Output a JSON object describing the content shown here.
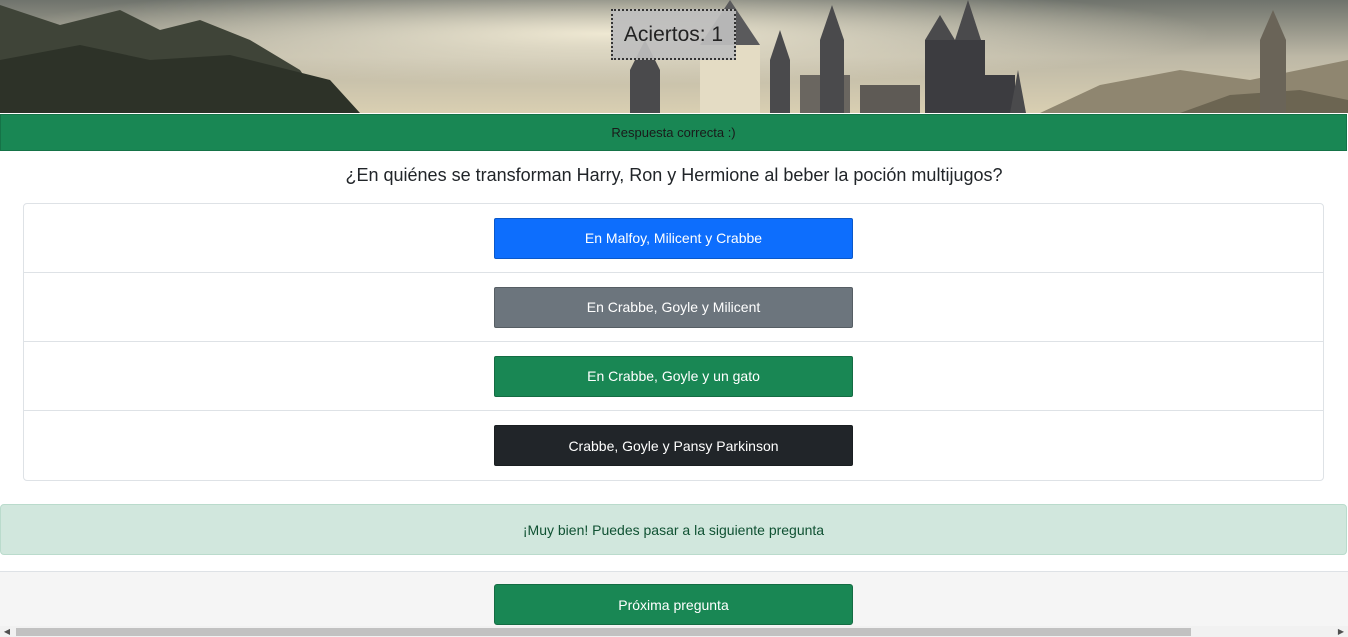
{
  "header": {
    "score_text": "Aciertos: 1"
  },
  "status": {
    "message": "Respuesta correcta :)"
  },
  "question": {
    "text": "¿En quiénes se transforman Harry, Ron y Hermione al beber la poción multijugos?"
  },
  "options": [
    {
      "label": "En Malfoy, Milicent y Crabbe",
      "color": "#0d6efd"
    },
    {
      "label": "En Crabbe, Goyle y Milicent",
      "color": "#6c757d"
    },
    {
      "label": "En Crabbe, Goyle y un gato",
      "color": "#198754"
    },
    {
      "label": "Crabbe, Goyle y Pansy Parkinson",
      "color": "#212529"
    }
  ],
  "feedback": {
    "message": "¡Muy bien! Puedes pasar a la siguiente pregunta"
  },
  "footer": {
    "next_label": "Próxima pregunta"
  },
  "scrollbar": {
    "left_arrow": "◀",
    "right_arrow": "▶"
  },
  "colors": {
    "success": "#198754",
    "primary": "#0d6efd",
    "secondary": "#6c757d",
    "dark": "#212529",
    "alert_bg": "#d1e7dd"
  }
}
